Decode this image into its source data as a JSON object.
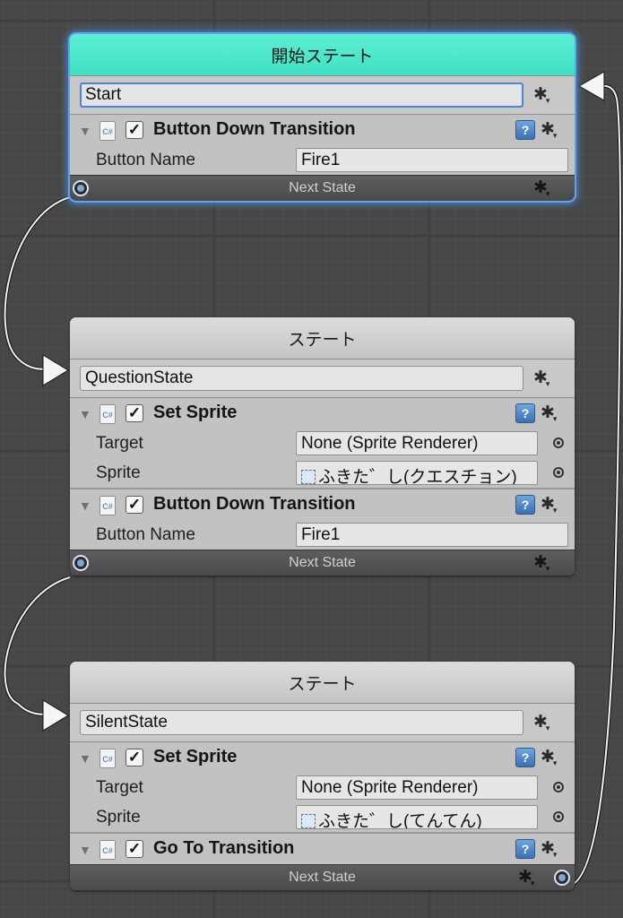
{
  "nodes": [
    {
      "header": "開始ステート",
      "name": "Start",
      "components": [
        {
          "title": "Button Down Transition",
          "props": [
            {
              "label": "Button Name",
              "value": "Fire1"
            }
          ]
        }
      ],
      "footer": "Next State"
    },
    {
      "header": "ステート",
      "name": "QuestionState",
      "components": [
        {
          "title": "Set Sprite",
          "props": [
            {
              "label": "Target",
              "value": "None (Sprite Renderer)"
            },
            {
              "label": "Sprite",
              "value": "ふきた゛し(クエスチョン)"
            }
          ]
        },
        {
          "title": "Button Down Transition",
          "props": [
            {
              "label": "Button Name",
              "value": "Fire1"
            }
          ]
        }
      ],
      "footer": "Next State"
    },
    {
      "header": "ステート",
      "name": "SilentState",
      "components": [
        {
          "title": "Set Sprite",
          "props": [
            {
              "label": "Target",
              "value": "None (Sprite Renderer)"
            },
            {
              "label": "Sprite",
              "value": "ふきた゛し(てんてん)"
            }
          ]
        },
        {
          "title": "Go To Transition",
          "props": []
        }
      ],
      "footer": "Next State"
    }
  ],
  "icons": {
    "gear": "gear-icon",
    "script": "csharp-script-icon",
    "help": "help-icon",
    "fold": "foldout-arrow-icon",
    "picker": "object-picker-icon",
    "port": "connection-port-icon",
    "sprite": "sprite-icon"
  },
  "glyphs": {
    "gear": "✱",
    "caret": "▾",
    "fold": "▼",
    "check": "✓",
    "script": "C#",
    "help": "?"
  },
  "colors": {
    "canvas": "#474747",
    "start_header": "#47e6c8",
    "selection_glow": "#5aa4f5",
    "node_body": "#c2c2c2",
    "footer": "#505050",
    "wire": "#ffffff"
  }
}
